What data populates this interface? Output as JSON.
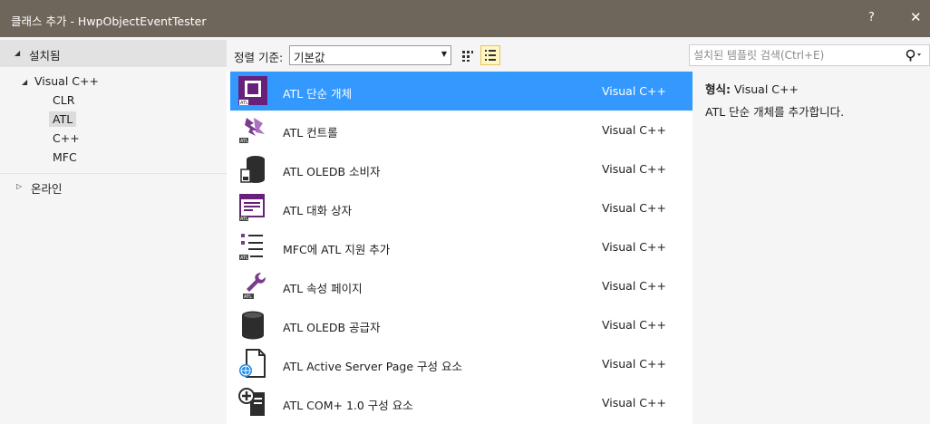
{
  "window": {
    "title": "클래스 추가 - HwpObjectEventTester",
    "help_label": "?",
    "close_label": "✕"
  },
  "tree": {
    "installed_label": "설치됨",
    "visual_cpp_label": "Visual C++",
    "children": [
      "CLR",
      "ATL",
      "C++",
      "MFC"
    ],
    "selected": "ATL",
    "online_label": "온라인"
  },
  "toolbar": {
    "sort_label": "정렬 기준:",
    "sort_value": "기본값",
    "search_placeholder": "설치된 템플릿 검색(Ctrl+E)"
  },
  "templates": [
    {
      "name": "ATL 단순 개체",
      "lang": "Visual C++",
      "icon": "atl-simple-object-icon",
      "selected": true
    },
    {
      "name": "ATL 컨트롤",
      "lang": "Visual C++",
      "icon": "atl-control-icon"
    },
    {
      "name": "ATL OLEDB 소비자",
      "lang": "Visual C++",
      "icon": "oledb-consumer-icon"
    },
    {
      "name": "ATL 대화 상자",
      "lang": "Visual C++",
      "icon": "atl-dialog-icon"
    },
    {
      "name": "MFC에 ATL 지원 추가",
      "lang": "Visual C++",
      "icon": "atl-support-icon"
    },
    {
      "name": "ATL 속성 페이지",
      "lang": "Visual C++",
      "icon": "property-page-icon"
    },
    {
      "name": "ATL OLEDB 공급자",
      "lang": "Visual C++",
      "icon": "oledb-provider-icon"
    },
    {
      "name": "ATL Active Server Page 구성 요소",
      "lang": "Visual C++",
      "icon": "asp-component-icon"
    },
    {
      "name": "ATL COM+ 1.0 구성 요소",
      "lang": "Visual C++",
      "icon": "com-plus-component-icon"
    }
  ],
  "detail": {
    "type_label": "형식:",
    "type_value": "Visual C++",
    "description": "ATL 단순 개체를 추가합니다."
  },
  "colors": {
    "titlebar": "#6f665b",
    "selection": "#3399ff",
    "pane": "#f5f5f5",
    "icon_purple": "#68217a"
  }
}
